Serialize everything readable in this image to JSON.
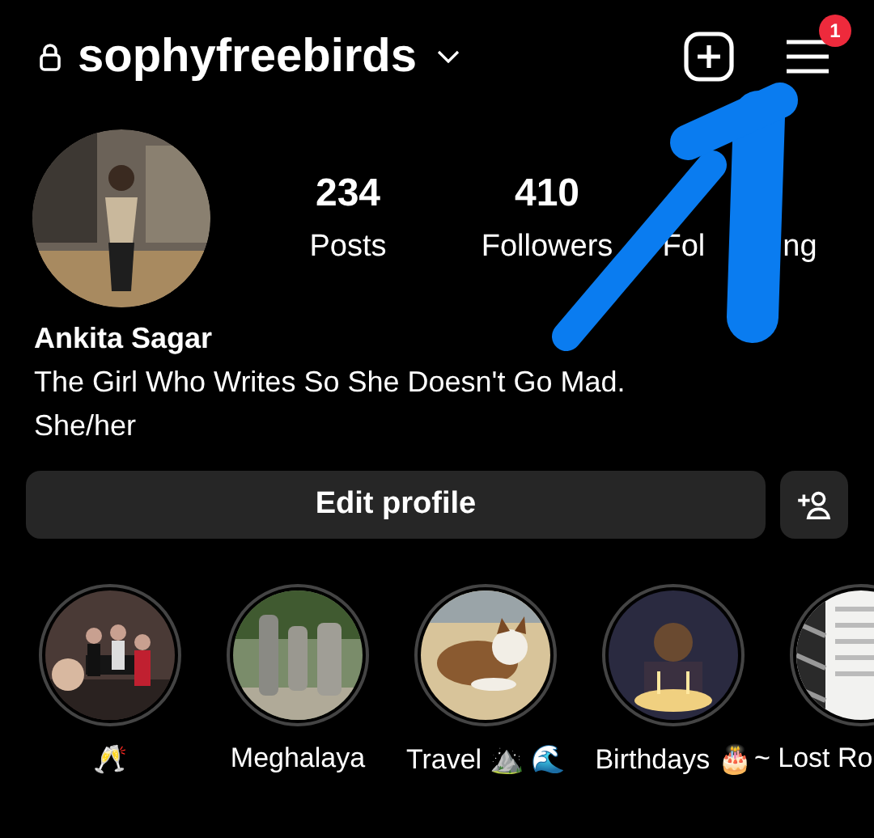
{
  "header": {
    "username": "sophyfreebirds",
    "private": true,
    "notifications": "1"
  },
  "profile": {
    "stats": [
      {
        "count": "234",
        "label_parts": [
          "Posts"
        ]
      },
      {
        "count": "410",
        "label_parts": [
          "Followers"
        ]
      },
      {
        "label_parts": [
          "Fol",
          "ng"
        ]
      }
    ],
    "name": "Ankita Sagar",
    "bio": "The Girl Who Writes So She Doesn't Go Mad.",
    "pronouns": "She/her"
  },
  "edit_button": "Edit profile",
  "highlights": [
    {
      "label": "🥂"
    },
    {
      "label": "Meghalaya"
    },
    {
      "label": "Travel ⛰️ 🌊"
    },
    {
      "label": "Birthdays 🎂"
    },
    {
      "label": "~ Lost Ro"
    }
  ],
  "annotation": {
    "kind": "arrow",
    "color": "#0a7cf0"
  }
}
